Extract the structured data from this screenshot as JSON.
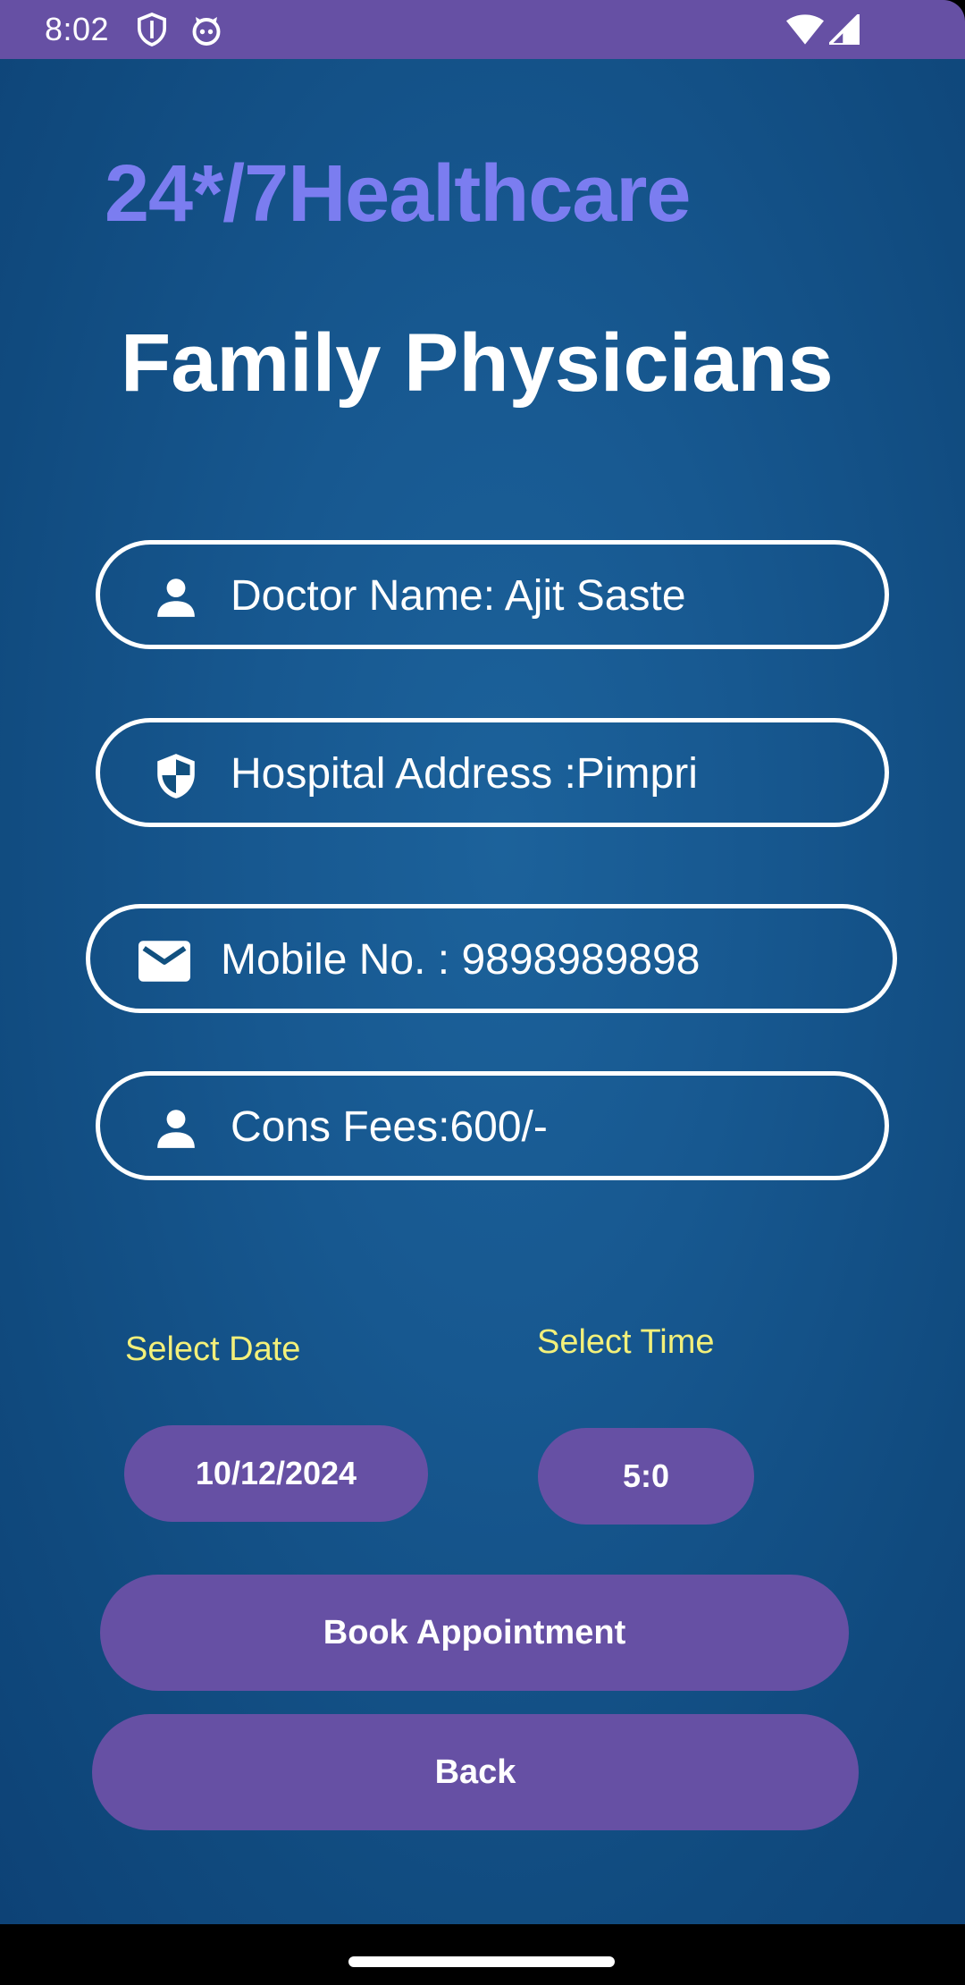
{
  "status_bar": {
    "time": "8:02",
    "color": "#6650a4",
    "icons": [
      "shield-icon",
      "app-face-icon",
      "wifi-icon",
      "signal-icon"
    ]
  },
  "header": {
    "app_title": "24*/7Healthcare",
    "page_title": "Family Physicians",
    "app_title_color": "#7b7df0"
  },
  "fields": {
    "doctor_name": {
      "text": "Doctor Name: Ajit Saste",
      "icon": "person-icon"
    },
    "hospital_address": {
      "text": "Hospital Address :Pimpri",
      "icon": "shield-icon"
    },
    "mobile": {
      "text": "Mobile No. : 9898989898",
      "icon": "mail-icon"
    },
    "fees": {
      "text": "Cons Fees:600/-",
      "icon": "person-icon"
    }
  },
  "booking": {
    "date_label": "Select Date",
    "time_label": "Select Time",
    "date_value": "10/12/2024",
    "time_value": "5:0",
    "label_color": "#f3f07a"
  },
  "actions": {
    "book_label": "Book Appointment",
    "back_label": "Back",
    "button_color": "#6650a4"
  }
}
